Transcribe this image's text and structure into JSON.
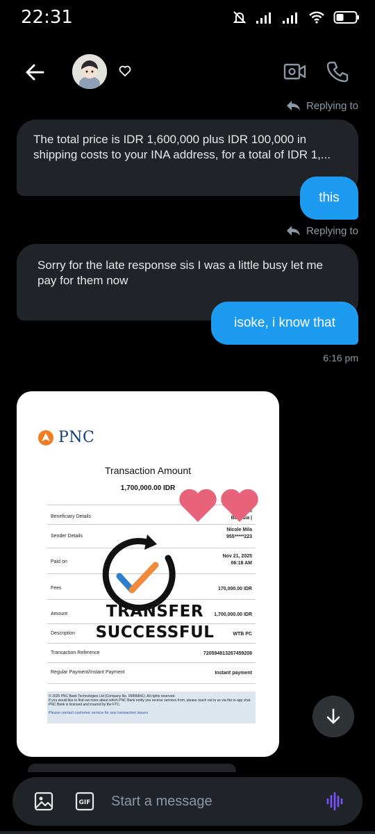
{
  "status_bar": {
    "time": "22:31"
  },
  "header": {
    "avatar_alt": "profile avatar"
  },
  "messages": {
    "reply_label_1": "Replying to",
    "incoming_1": "The total price is IDR 1,600,000 plus IDR 100,000 in shipping costs to your INA address, for a total of IDR 1,...",
    "outgoing_1": "this",
    "reply_label_2": "Replying to",
    "incoming_2": "Sorry for the late response sis I was a little busy let me pay for them now",
    "outgoing_2": "isoke, i know that",
    "timestamp": "6:16 pm"
  },
  "receipt": {
    "bank_name": "PNC",
    "title": "Transaction Amount",
    "amount": "1,700,000.00 IDR",
    "rows": [
      {
        "label": "Beneficiary Details",
        "value": "a Si\nBa    sia |"
      },
      {
        "label": "Sender Details",
        "value": "Nicole Mila\n955*****223"
      },
      {
        "label": "Paid on",
        "value": "Nov 21, 2025\n06:18 AM"
      },
      {
        "label": "Fees",
        "value": "170,000.00 IDR"
      },
      {
        "label": "Amount",
        "value": "1,700,000.00 IDR"
      },
      {
        "label": "Description",
        "value": "WTB PC"
      },
      {
        "label": "Transaction Reference",
        "value": "720594813267459208"
      },
      {
        "label": "Regular Payment/Instant Payment",
        "value": "Instant payment"
      }
    ],
    "stamp_line_1": "TRANSFER",
    "stamp_line_2": "SUCCESSFUL",
    "footer_line_1": "© 2025 PNC Bank Technologies Ltd (Company No. 09896841). All rights reserved.",
    "footer_line_2": "If you would like to find out more about which PNC Bank entity you receive services from, please reach out to us via the in-app chat.",
    "footer_line_3": "PNC Bank is licensed and insured by the FTC.",
    "footer_link": "Please contact customer service for any transaction issues"
  },
  "composer": {
    "placeholder": "Start a message",
    "gif_label": "GIF"
  },
  "colors": {
    "accent": "#1d9bf0",
    "bubble_in": "#202327",
    "background": "#000000",
    "voice_icon": "#7856ff"
  }
}
